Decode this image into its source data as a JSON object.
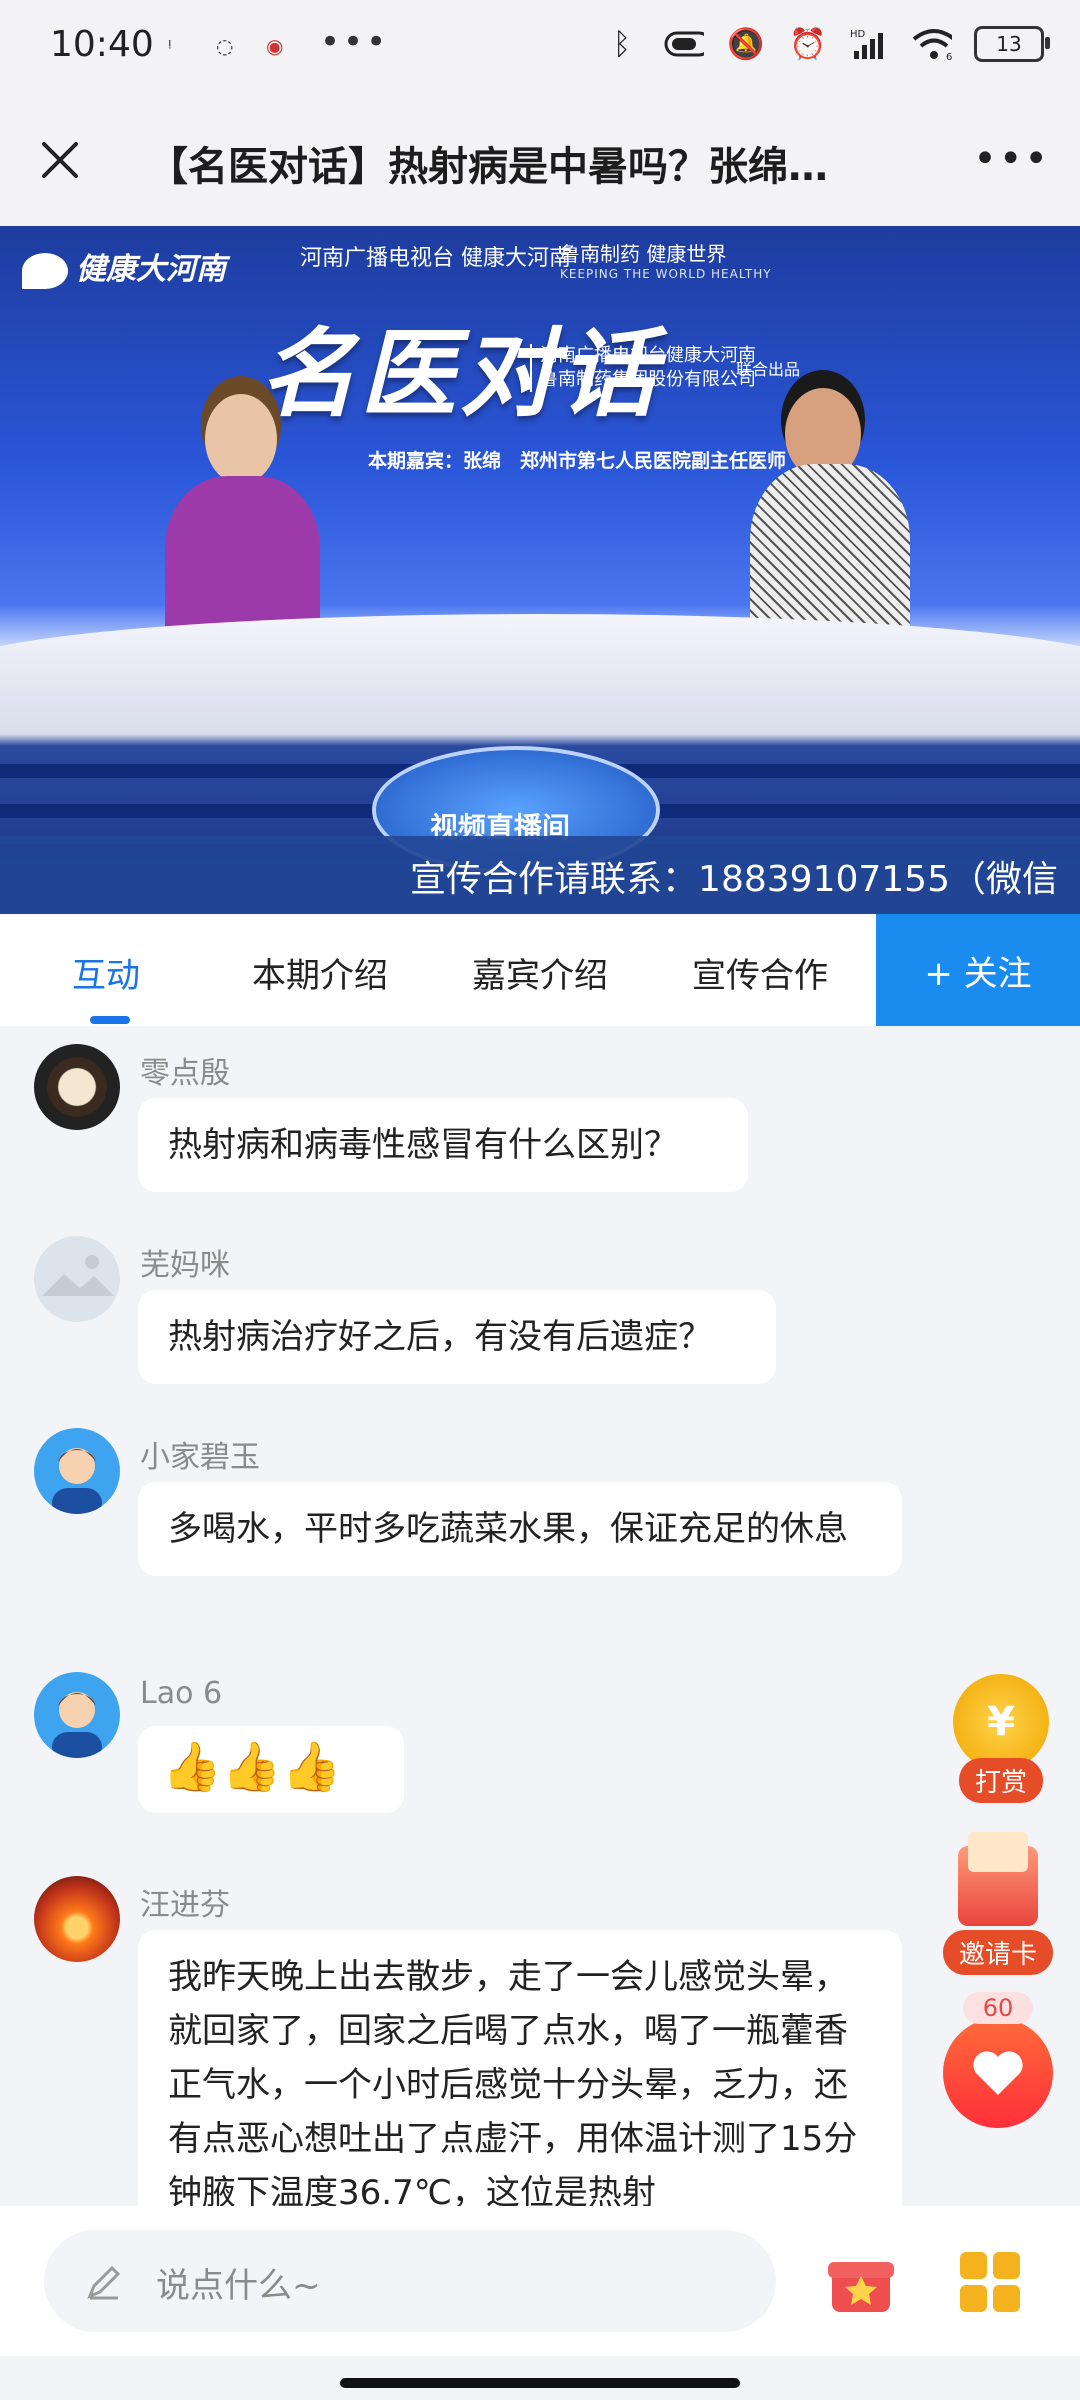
{
  "status": {
    "time": "10:40",
    "battery": "13",
    "hd": "HD",
    "wifi_num": "6"
  },
  "header": {
    "title": "【名医对话】热射病是中暑吗？张绵…"
  },
  "video": {
    "logo_main": "健康大河南",
    "logo_mid": "河南广播电视台 健康大河南",
    "logo_right": "鲁南制药 健康世界",
    "logo_right_en": "KEEPING THE WORLD HEALTHY",
    "show_name": "名医对话",
    "producer_1": "河南广播电视台健康大河南",
    "producer_2": "鲁南制药集团股份有限公司",
    "producer_tag": "联合出品",
    "guest_line": "本期嘉宾：张绵　郑州市第七人民医院副主任医师",
    "studio_text": "视频直播间",
    "ticker": "宣传合作请联系：18839107155（微信"
  },
  "tabs": [
    {
      "label": "互动"
    },
    {
      "label": "本期介绍"
    },
    {
      "label": "嘉宾介绍"
    },
    {
      "label": "宣传合作"
    }
  ],
  "follow_label": "+ 关注",
  "messages": [
    {
      "user": "零点殷",
      "text": "热射病和病毒性感冒有什么区别？"
    },
    {
      "user": "芜妈咪",
      "text": "热射病治疗好之后，有没有后遗症？"
    },
    {
      "user": "小家碧玉",
      "text": "多喝水，平时多吃蔬菜水果，保证充足的休息"
    },
    {
      "user": "Lao 6",
      "text": "👍👍👍"
    },
    {
      "user": "汪进芬",
      "text": "我昨天晚上出去散步，走了一会儿感觉头晕，就回家了，回家之后喝了点水，喝了一瓶藿香正气水，一个小时后感觉十分头晕，乏力，还有点恶心想吐出了点虚汗，用体温计测了15分钟腋下温度36.7℃，这位是热射"
    }
  ],
  "floating": {
    "reward": "打赏",
    "invite": "邀请卡",
    "like_count": "60"
  },
  "input": {
    "placeholder": "说点什么~"
  }
}
